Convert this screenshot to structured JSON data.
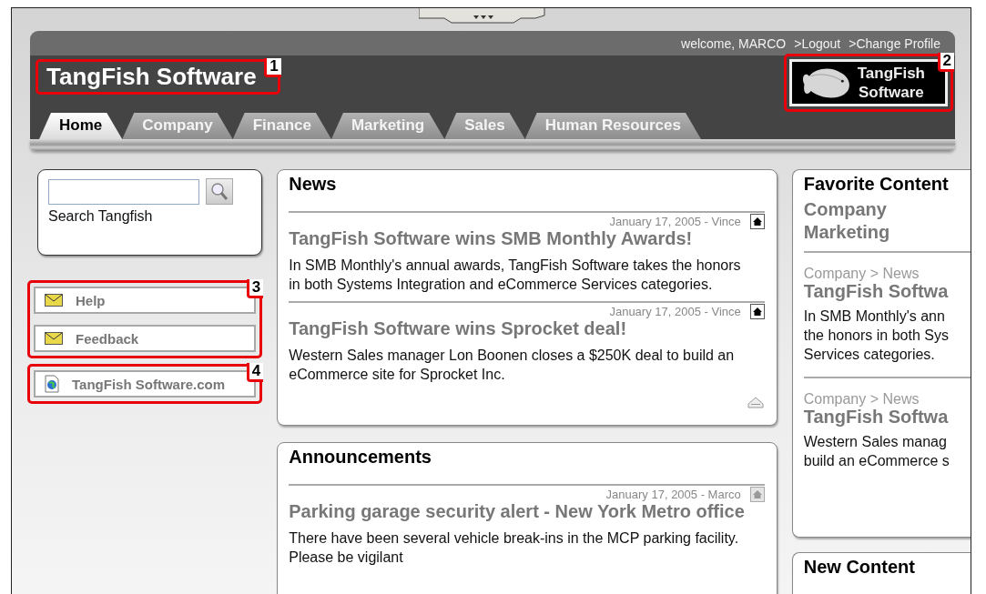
{
  "header": {
    "welcome": "welcome, MARCO",
    "user_links": [
      ">Logout",
      ">Change Profile"
    ],
    "site_title": "TangFish Software",
    "title_callout": "1",
    "logo": {
      "line_1": "TangFish",
      "line_2": "Software",
      "callout": "2"
    },
    "tabs": [
      {
        "label": "Home",
        "selected": true
      },
      {
        "label": "Company",
        "selected": false
      },
      {
        "label": "Finance",
        "selected": false
      },
      {
        "label": "Marketing",
        "selected": false
      },
      {
        "label": "Sales",
        "selected": false
      },
      {
        "label": "Human Resources",
        "selected": false
      }
    ]
  },
  "sidebar": {
    "search": {
      "label": "Search Tangfish"
    },
    "links": [
      {
        "kind": "mail",
        "label": "Help"
      },
      {
        "kind": "mail",
        "label": "Feedback"
      }
    ],
    "links_callout": "3",
    "site_link": {
      "kind": "page",
      "label": "TangFish Software.com",
      "callout": "4"
    }
  },
  "news": {
    "title": "News",
    "back_to_top": true,
    "items": [
      {
        "meta": "January 17, 2005 - Vince",
        "home_enabled": true,
        "headline": "TangFish Software wins SMB Monthly Awards!",
        "body": "In SMB Monthly's annual awards, TangFish Software takes the honors in both Systems Integration and eCommerce Services categories."
      },
      {
        "meta": "January 17, 2005 - Vince",
        "home_enabled": true,
        "headline": "TangFish Software wins Sprocket deal!",
        "body": "Western Sales manager Lon Boonen closes a $250K deal to build an eCommerce site for Sprocket Inc."
      }
    ]
  },
  "announcements": {
    "title": "Announcements",
    "items": [
      {
        "meta": "January 17, 2005 - Marco",
        "home_enabled": false,
        "headline": "Parking garage security alert - New York Metro office",
        "body": "There have been several vehicle break-ins in the MCP parking facility.  Please be vigilant"
      }
    ]
  },
  "favorite_content": {
    "title": "Favorite Content",
    "categories": [
      "Company",
      "Marketing"
    ],
    "items": [
      {
        "path": "Company > News",
        "headline": "TangFish Softwa",
        "body_lines": [
          "In SMB Monthly's ann",
          "the honors in both Sys",
          "Services categories."
        ]
      },
      {
        "path": "Company > News",
        "headline": "TangFish Softwa",
        "body_lines": [
          "Western Sales manag",
          "build an eCommerce s"
        ]
      }
    ]
  },
  "new_content": {
    "title": "New Content"
  }
}
